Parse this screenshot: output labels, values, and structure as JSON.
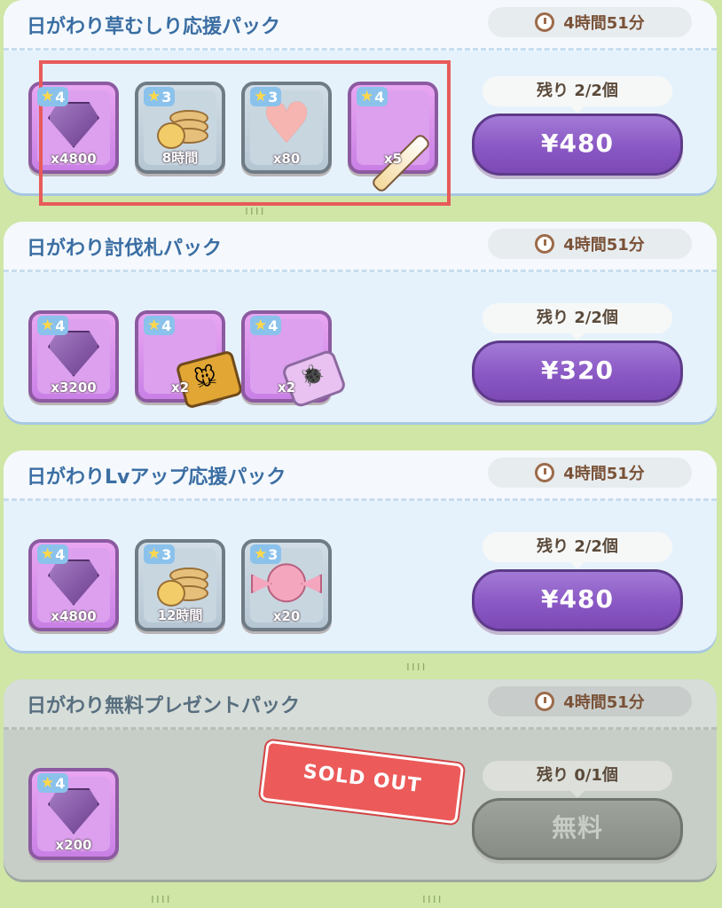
{
  "packs": [
    {
      "title": "日がわり草むしり応援パック",
      "timer": "4時間51分",
      "remaining": "残り 2/2個",
      "price": "¥480",
      "items": [
        {
          "stars": "4",
          "qty": "x4800",
          "icon": "gem-icon",
          "rarity": "r4"
        },
        {
          "stars": "3",
          "qty": "8時間",
          "icon": "coins-icon",
          "rarity": "r3"
        },
        {
          "stars": "3",
          "qty": "x80",
          "icon": "heart-icon",
          "rarity": "r3"
        },
        {
          "stars": "4",
          "qty": "x5",
          "icon": "stick-icon",
          "rarity": "r4"
        }
      ]
    },
    {
      "title": "日がわり討伐札パック",
      "timer": "4時間51分",
      "remaining": "残り 2/2個",
      "price": "¥320",
      "items": [
        {
          "stars": "4",
          "qty": "x3200",
          "icon": "gem-icon",
          "rarity": "r4"
        },
        {
          "stars": "4",
          "qty": "x2",
          "icon": "ticket-icon",
          "rarity": "r4"
        },
        {
          "stars": "4",
          "qty": "x2",
          "icon": "bug-ticket-icon",
          "rarity": "r4"
        }
      ]
    },
    {
      "title": "日がわりLvアップ応援パック",
      "timer": "4時間51分",
      "remaining": "残り 2/2個",
      "price": "¥480",
      "items": [
        {
          "stars": "4",
          "qty": "x4800",
          "icon": "gem-icon",
          "rarity": "r4"
        },
        {
          "stars": "3",
          "qty": "12時間",
          "icon": "coins-icon",
          "rarity": "r3"
        },
        {
          "stars": "3",
          "qty": "x20",
          "icon": "candy-icon",
          "rarity": "r3"
        }
      ]
    },
    {
      "title": "日がわり無料プレゼントパック",
      "timer": "4時間51分",
      "remaining": "残り 0/1個",
      "price": "無料",
      "sold_out_label": "SOLD OUT",
      "items": [
        {
          "stars": "4",
          "qty": "x200",
          "icon": "gem-icon",
          "rarity": "r4"
        }
      ]
    }
  ]
}
